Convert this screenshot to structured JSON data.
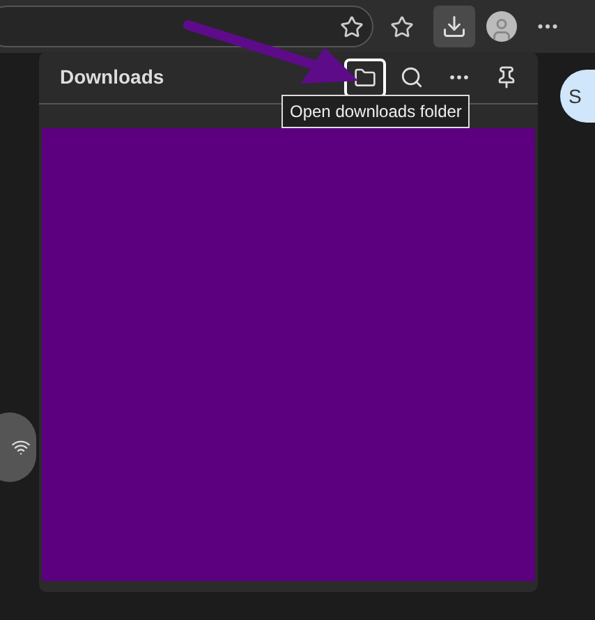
{
  "panel": {
    "title": "Downloads",
    "tooltip": "Open downloads folder"
  },
  "side_button": {
    "label": "S"
  }
}
